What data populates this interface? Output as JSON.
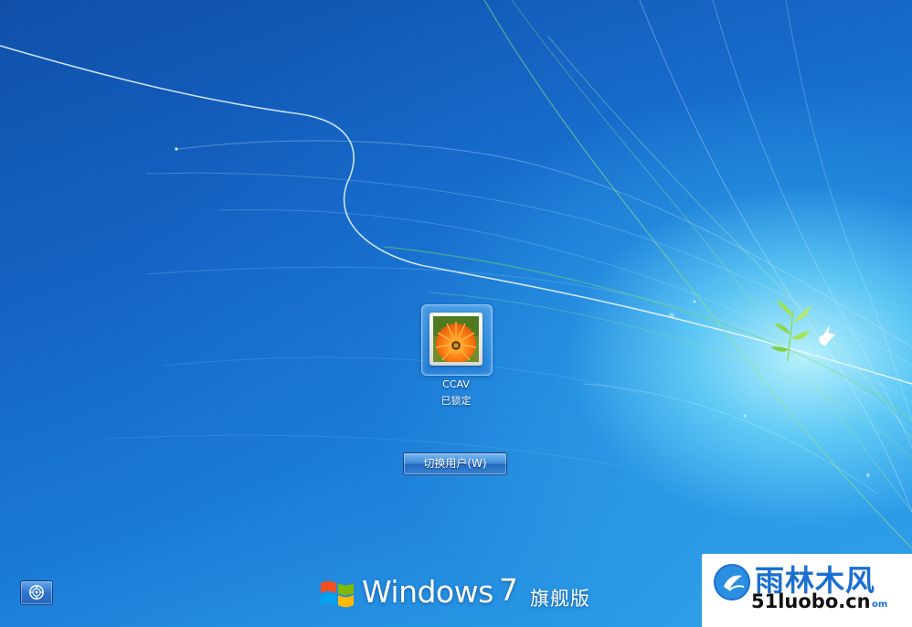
{
  "user": {
    "name": "CCAV",
    "status": "已锁定"
  },
  "actions": {
    "switch_user_label": "切换用户(W)"
  },
  "branding": {
    "product": "Windows",
    "version": "7",
    "edition": "旗舰版"
  },
  "watermark": {
    "title": "雨林木风",
    "url": "51luobo.cn",
    "url_tail": "om"
  },
  "icons": {
    "ease_of_access": "ease-of-access-icon",
    "windows_logo": "windows-flag-icon",
    "user_picture": "orange-flower-picture"
  },
  "colors": {
    "background_blue": "#1565c0",
    "glow": "#bef5ff",
    "watermark_blue": "#1a6fd0"
  }
}
